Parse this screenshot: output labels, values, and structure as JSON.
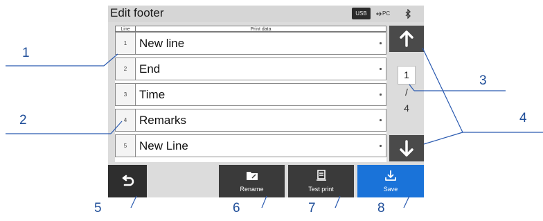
{
  "screen": {
    "title": "Edit footer",
    "status": {
      "usb": "USB",
      "pc": "PC",
      "bluetooth_icon": "bluetooth-icon"
    },
    "table": {
      "header_line": "Line",
      "header_print": "Print data",
      "rows": [
        {
          "num": "1",
          "text": "New line"
        },
        {
          "num": "2",
          "text": "End"
        },
        {
          "num": "3",
          "text": "Time"
        },
        {
          "num": "4",
          "text": "Remarks"
        },
        {
          "num": "5",
          "text": "New Line"
        }
      ]
    },
    "pager": {
      "current": "1",
      "separator": "/",
      "total": "4"
    },
    "buttons": {
      "back_icon": "back-arrow-icon",
      "rename": "Rename",
      "test_print": "Test print",
      "save": "Save"
    },
    "colors": {
      "accent": "#1a73d9",
      "callout": "#1f4e99"
    }
  },
  "callouts": [
    "1",
    "2",
    "3",
    "4",
    "5",
    "6",
    "7",
    "8"
  ]
}
